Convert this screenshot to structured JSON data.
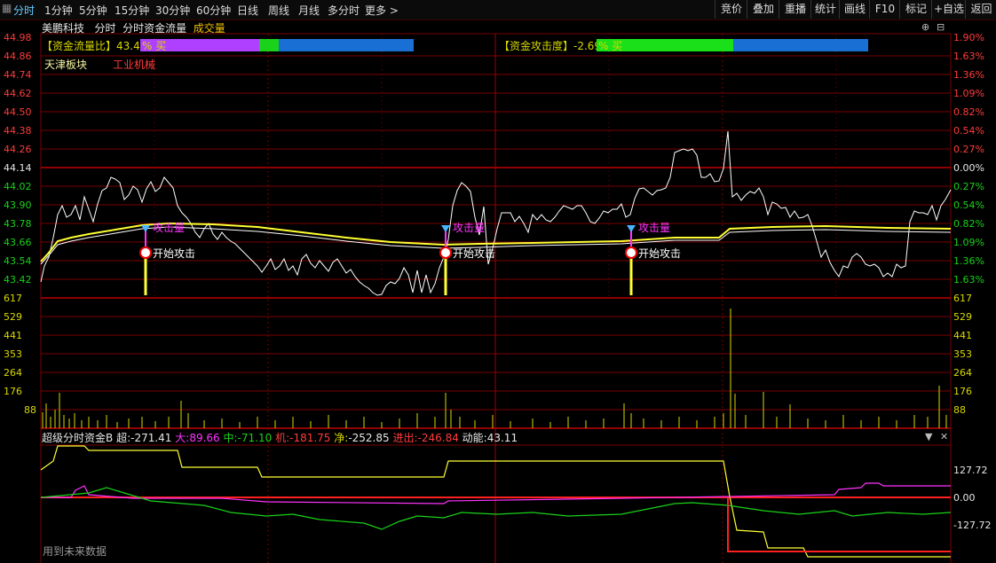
{
  "toolbar": {
    "grid_icon": "grid-icon",
    "tabs": [
      "分时",
      "1分钟",
      "5分钟",
      "15分钟",
      "30分钟",
      "60分钟",
      "日线",
      "周线",
      "月线",
      "多分时",
      "更多 >"
    ],
    "right_buttons": [
      "竞价",
      "叠加",
      "重播",
      "统计",
      "画线",
      "F10",
      "标记",
      "+自选",
      "返回"
    ]
  },
  "subtitle": {
    "stock": "美鹏科技",
    "items": [
      "分时",
      "分时资金流量",
      "成交量"
    ]
  },
  "indicators": {
    "flow_ratio_label": "【资金流量比】",
    "flow_ratio_value": "43.48",
    "flow_ratio_buy": "% 买",
    "attack_label": "【资金攻击度】",
    "attack_value": "-2.69",
    "attack_buy": "% 买"
  },
  "board": {
    "name": "天津板块",
    "sector": "工业机械"
  },
  "price_axis": [
    "44.98",
    "44.86",
    "44.74",
    "44.62",
    "44.50",
    "44.38",
    "44.26",
    "44.14",
    "44.02",
    "43.90",
    "43.78",
    "43.66",
    "43.54",
    "43.42"
  ],
  "pct_axis": [
    "1.90%",
    "1.63%",
    "1.36%",
    "1.09%",
    "0.82%",
    "0.54%",
    "0.27%",
    "0.00%",
    "0.27%",
    "0.54%",
    "0.82%",
    "1.09%",
    "1.36%",
    "1.63%"
  ],
  "vol_axis": [
    "617",
    "529",
    "441",
    "353",
    "264",
    "176",
    "88"
  ],
  "signals": {
    "attack_volume": "攻击量",
    "start_attack": "开始攻击"
  },
  "fund": {
    "title": "超级分时资金B",
    "super_label": "超:",
    "super_value": "-271.41",
    "big_label": "大:",
    "big_value": "89.66",
    "mid_label": "中:",
    "mid_value": "-71.10",
    "inst_label": "机:",
    "inst_value": "-181.75",
    "net_label": "净:",
    "net_value": "-252.85",
    "inout_label": "进出:",
    "inout_value": "-246.84",
    "energy_label": "动能:",
    "energy_value": "43.11",
    "axis": [
      "127.72",
      "0.00",
      "-127.72"
    ],
    "future_note": "用到未来数据"
  },
  "colors": {
    "up": "#ff3b3b",
    "down": "#19d219",
    "grid": "#7a0000",
    "price": "#ffffff",
    "avg": "#ffff33",
    "magenta": "#ff33ff"
  }
}
